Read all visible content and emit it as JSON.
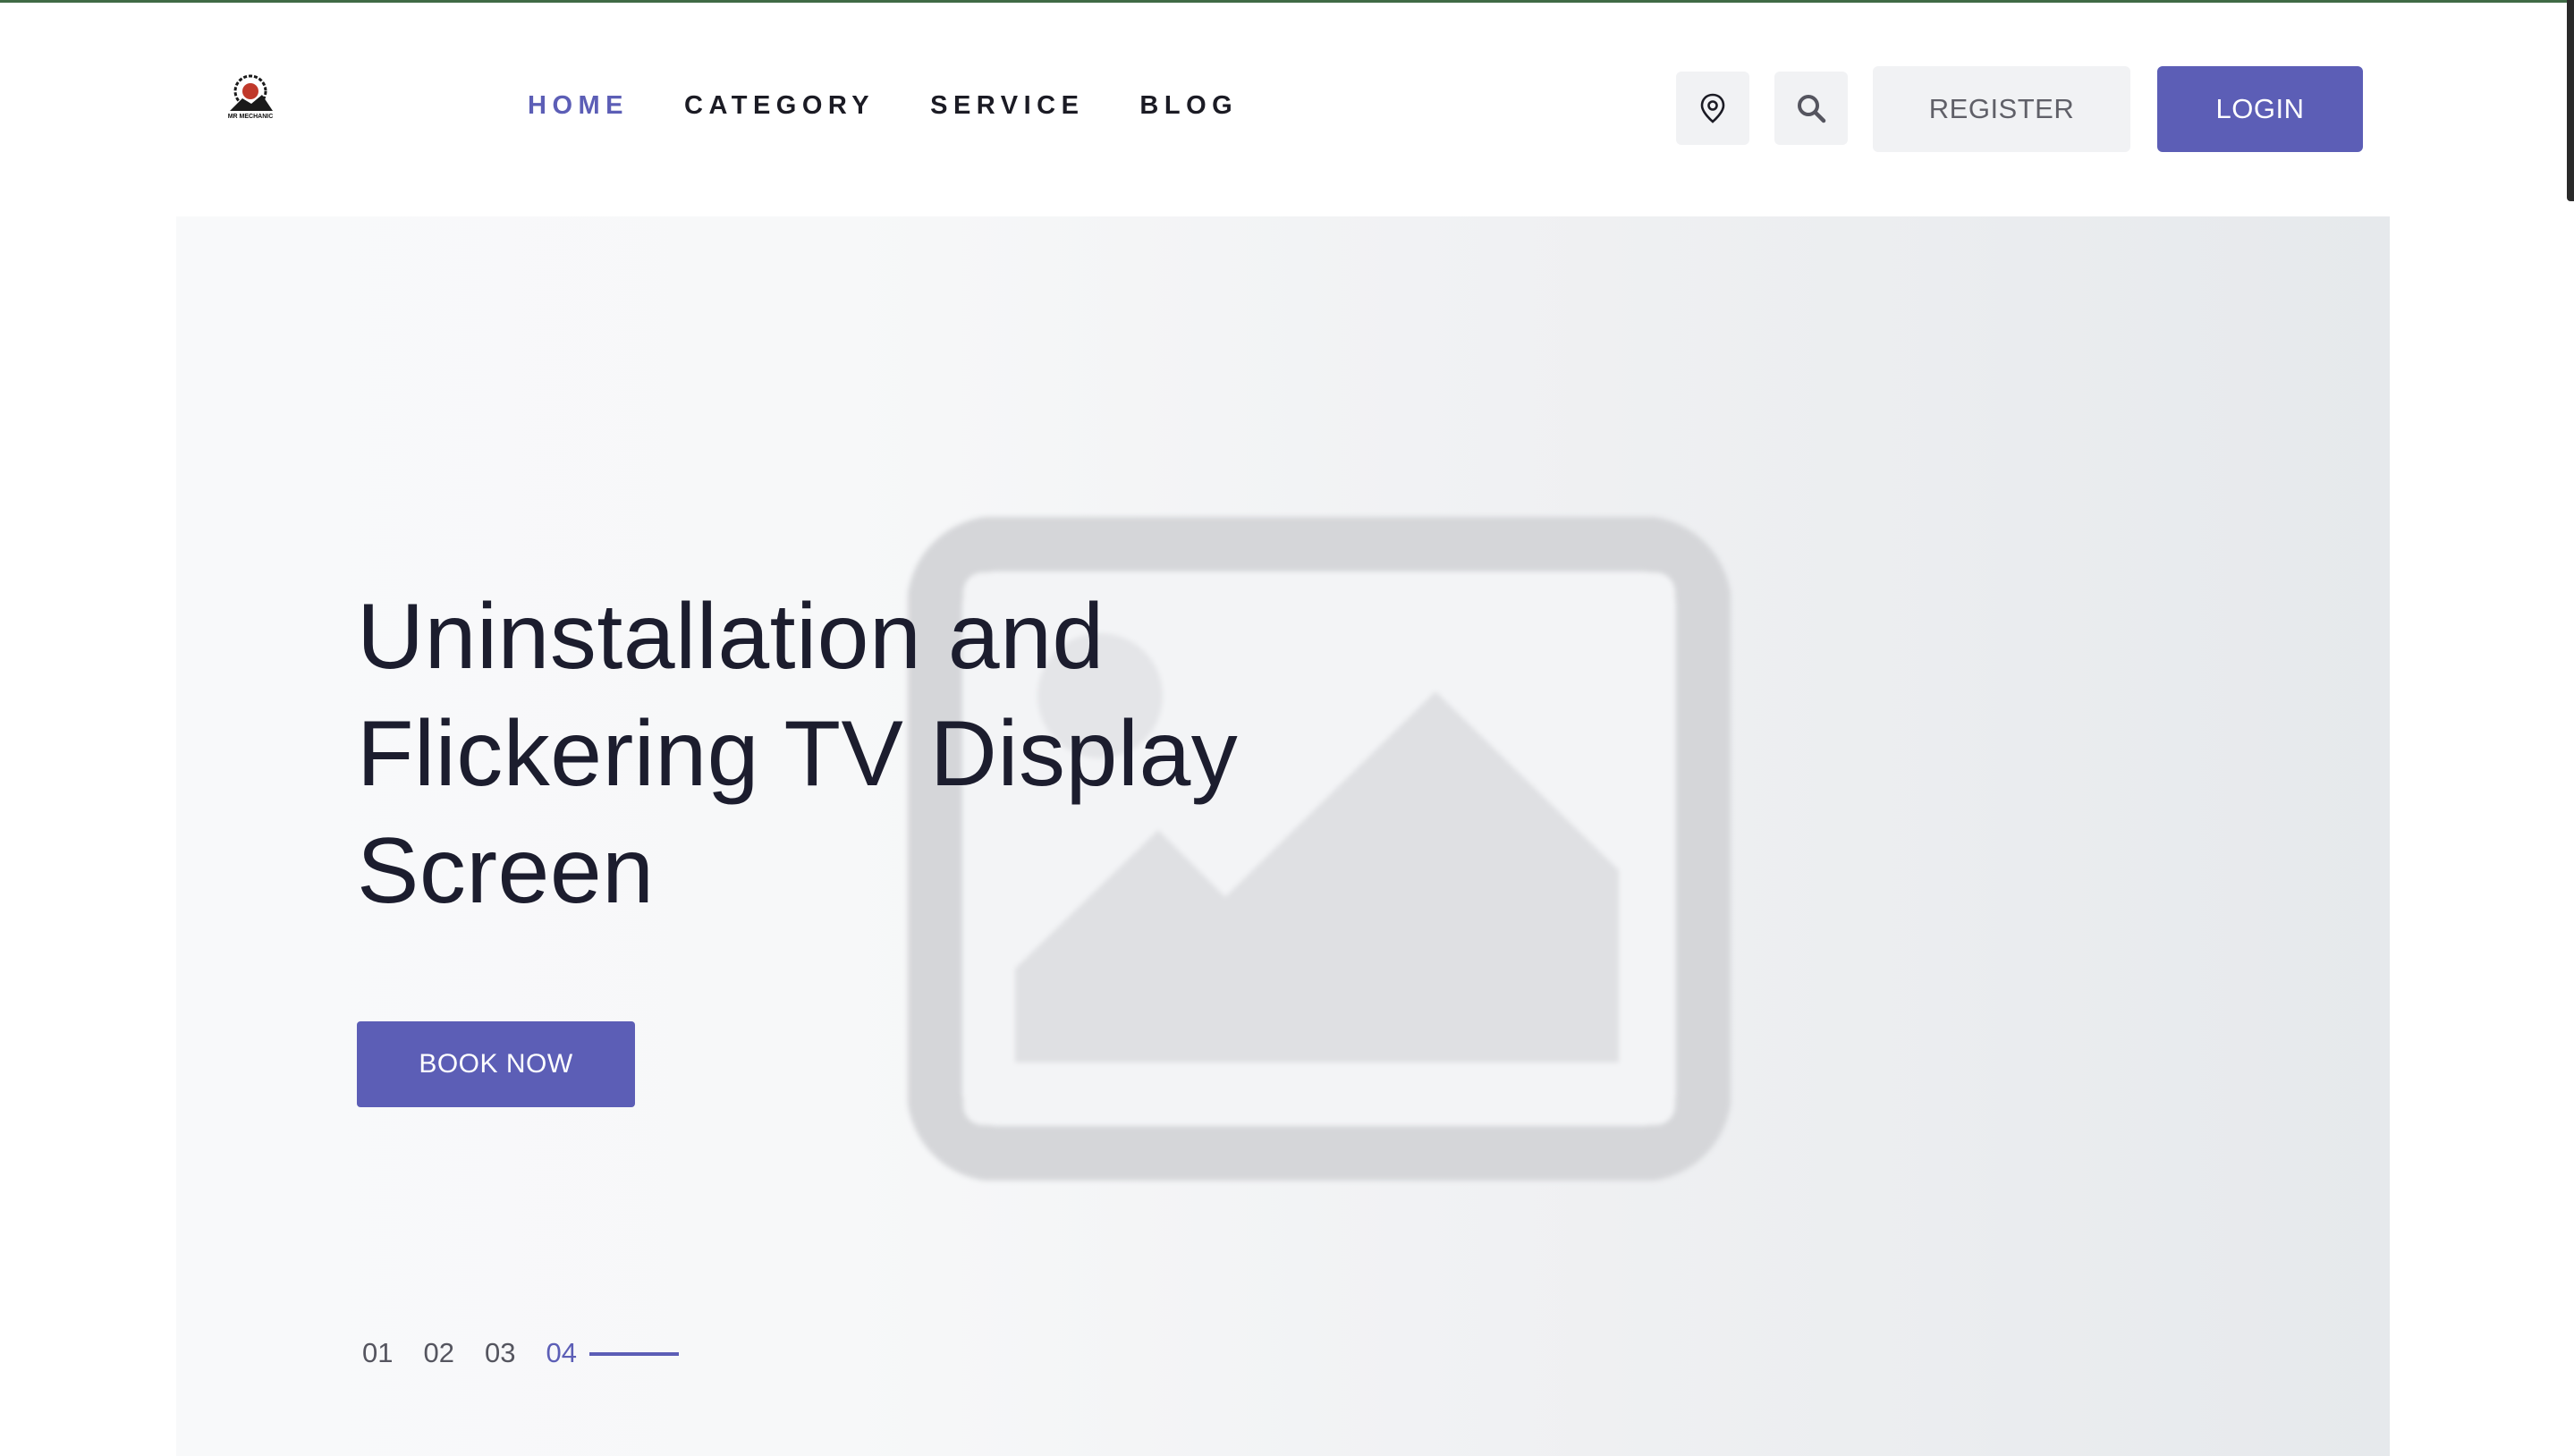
{
  "brand": {
    "logo_icon": "mr-mechanic-logo",
    "logo_text": "MR MECHANIC"
  },
  "nav": {
    "items": [
      {
        "label": "HOME",
        "active": true
      },
      {
        "label": "CATEGORY",
        "active": false
      },
      {
        "label": "SERVICE",
        "active": false
      },
      {
        "label": "BLOG",
        "active": false
      }
    ]
  },
  "header": {
    "location_icon": "location-pin-icon",
    "search_icon": "search-icon",
    "register_label": "REGISTER",
    "login_label": "LOGIN"
  },
  "hero": {
    "title_line1": "Uninstallation and",
    "title_line2": "Flickering TV Display",
    "title_line3": "Screen",
    "cta_label": "BOOK NOW",
    "image_icon": "image-placeholder-icon",
    "slides": [
      "01",
      "02",
      "03",
      "04"
    ],
    "active_slide": "04"
  },
  "colors": {
    "accent": "#5c5eb6",
    "text_dark": "#1c1d2e",
    "button_light": "#f1f2f4",
    "top_border": "#3f6a45"
  }
}
